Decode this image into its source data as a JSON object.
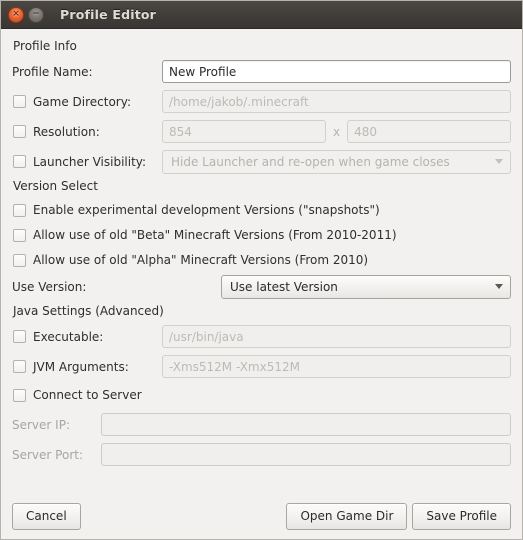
{
  "window": {
    "title": "Profile Editor",
    "close_icon": "close-icon",
    "minimize_icon": "minimize-icon",
    "close_glyph": "×",
    "minimize_glyph": "−"
  },
  "profile_info": {
    "section_label": "Profile Info",
    "profile_name": {
      "label": "Profile Name:",
      "value": "New Profile"
    },
    "game_directory": {
      "label": "Game Directory:",
      "placeholder": "/home/jakob/.minecraft",
      "checked": false
    },
    "resolution": {
      "label": "Resolution:",
      "width_placeholder": "854",
      "height_placeholder": "480",
      "separator": "x",
      "checked": false
    },
    "launcher_visibility": {
      "label": "Launcher Visibility:",
      "value": "Hide Launcher and re-open when game closes",
      "checked": false
    }
  },
  "version_select": {
    "section_label": "Version Select",
    "options": [
      {
        "label": "Enable experimental development Versions (\"snapshots\")",
        "checked": false
      },
      {
        "label": "Allow use of old \"Beta\" Minecraft Versions (From 2010-2011)",
        "checked": false
      },
      {
        "label": "Allow use of old \"Alpha\" Minecraft Versions (From 2010)",
        "checked": false
      }
    ],
    "use_version": {
      "label": "Use Version:",
      "value": "Use latest Version"
    }
  },
  "java_settings": {
    "section_label": "Java Settings (Advanced)",
    "executable": {
      "label": "Executable:",
      "placeholder": "/usr/bin/java",
      "checked": false
    },
    "jvm_arguments": {
      "label": "JVM Arguments:",
      "placeholder": "-Xms512M -Xmx512M",
      "checked": false
    }
  },
  "server": {
    "connect_label": "Connect to Server",
    "connect_checked": false,
    "ip": {
      "label": "Server IP:",
      "value": ""
    },
    "port": {
      "label": "Server Port:",
      "value": ""
    }
  },
  "footer": {
    "cancel": "Cancel",
    "open_game_dir": "Open Game Dir",
    "save_profile": "Save Profile"
  }
}
